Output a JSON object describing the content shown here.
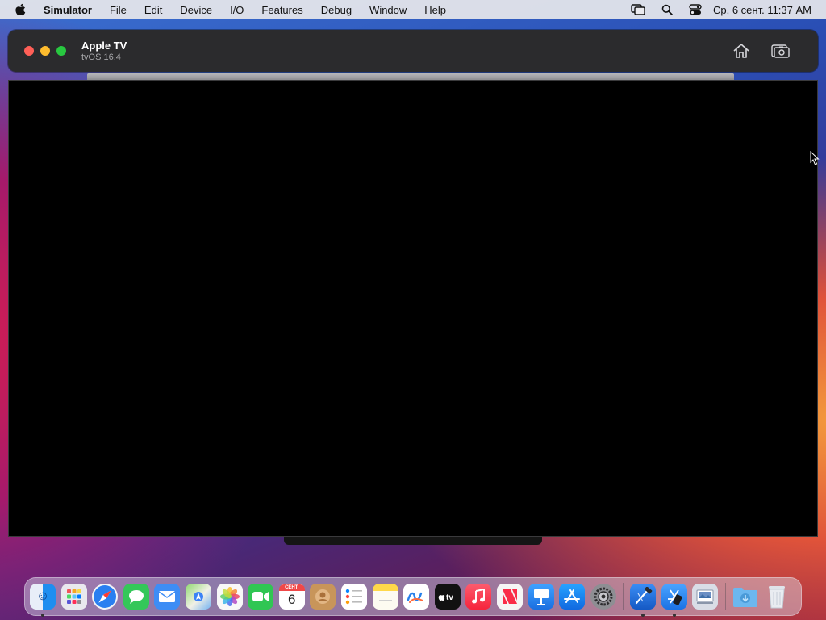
{
  "menubar": {
    "app_name": "Simulator",
    "items": [
      "File",
      "Edit",
      "Device",
      "I/O",
      "Features",
      "Debug",
      "Window",
      "Help"
    ],
    "clock": "Ср, 6 сент.  11:37 AM",
    "icons": [
      "screen-mirroring-icon",
      "spotlight-search-icon",
      "control-center-icon"
    ]
  },
  "window": {
    "title": "Apple TV",
    "subtitle": "tvOS 16.4",
    "toolbar_icons": [
      "home-icon",
      "screenshot-icon"
    ]
  },
  "dock": {
    "calendar": {
      "month": "СЕНТ.",
      "day": "6"
    },
    "apps": [
      {
        "name": "finder",
        "color": "#1e8ef0",
        "running": true
      },
      {
        "name": "launchpad",
        "color": "#e9e9ee",
        "running": false
      },
      {
        "name": "safari",
        "color": "#2a7ff0",
        "running": false
      },
      {
        "name": "messages",
        "color": "#34c759",
        "running": false
      },
      {
        "name": "mail",
        "color": "#3d8df5",
        "running": false
      },
      {
        "name": "maps",
        "color": "#7fcf6a",
        "running": false
      },
      {
        "name": "photos",
        "color": "#f5f5f5",
        "running": false
      },
      {
        "name": "facetime",
        "color": "#30c653",
        "running": false
      },
      {
        "name": "calendar",
        "color": "#ffffff",
        "running": false
      },
      {
        "name": "contacts",
        "color": "#c8955a",
        "running": false
      },
      {
        "name": "reminders",
        "color": "#ffffff",
        "running": false
      },
      {
        "name": "notes",
        "color": "#ffd84a",
        "running": false
      },
      {
        "name": "freeform",
        "color": "#ffffff",
        "running": false
      },
      {
        "name": "tv",
        "color": "#111111",
        "running": false
      },
      {
        "name": "music",
        "color": "#fa3b50",
        "running": false
      },
      {
        "name": "news",
        "color": "#f5f5f5",
        "running": false
      },
      {
        "name": "keynote",
        "color": "#2d8cf0",
        "running": false
      },
      {
        "name": "app-store",
        "color": "#1f8ef5",
        "running": false
      },
      {
        "name": "system-settings",
        "color": "#8e8e93",
        "running": false
      },
      {
        "name": "xcode",
        "color": "#1a73d9",
        "running": true
      },
      {
        "name": "simulator",
        "color": "#2a8cf0",
        "running": true
      },
      {
        "name": "preview",
        "color": "#d9dde6",
        "running": false
      },
      {
        "name": "downloads-folder",
        "color": "#6cb7ef",
        "running": false
      },
      {
        "name": "trash",
        "color": "#e8eaee",
        "running": false
      }
    ]
  }
}
